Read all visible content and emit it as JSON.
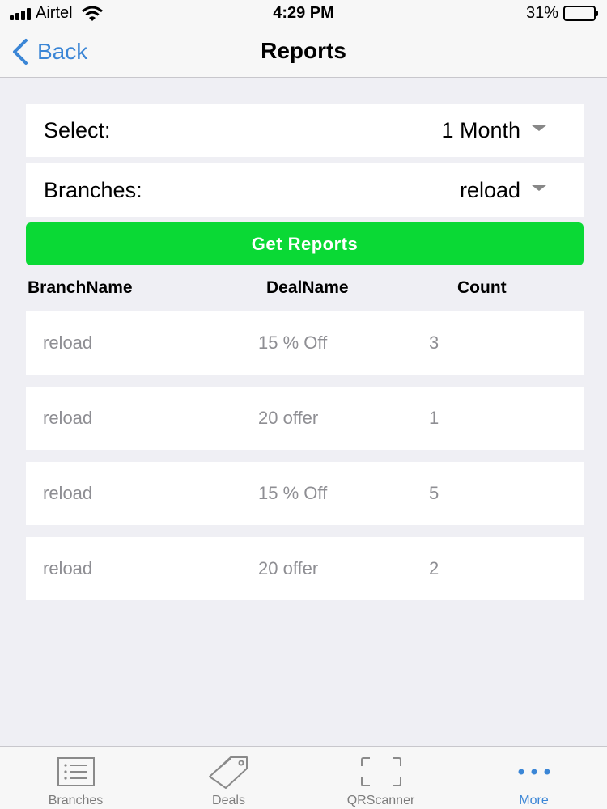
{
  "status_bar": {
    "carrier": "Airtel",
    "time": "4:29 PM",
    "battery": "31%",
    "battery_level": 0.31
  },
  "nav": {
    "back_label": "Back",
    "title": "Reports"
  },
  "filters": {
    "period_label": "Select:",
    "period_value": "1 Month",
    "branch_label": "Branches:",
    "branch_value": "reload"
  },
  "get_reports_label": "Get Reports",
  "table": {
    "headers": [
      "BranchName",
      "DealName",
      "Count"
    ],
    "rows": [
      {
        "branch": "reload",
        "deal": "15 % Off",
        "count": "3"
      },
      {
        "branch": "reload",
        "deal": "20 offer",
        "count": "1"
      },
      {
        "branch": "reload",
        "deal": "15 % Off",
        "count": "5"
      },
      {
        "branch": "reload",
        "deal": "20 offer",
        "count": "2"
      }
    ]
  },
  "tabs": [
    {
      "label": "Branches",
      "icon": "list-icon"
    },
    {
      "label": "Deals",
      "icon": "tag-icon"
    },
    {
      "label": "QRScanner",
      "icon": "qr-scan-icon"
    },
    {
      "label": "More",
      "icon": "more-dots-icon",
      "active": true
    }
  ],
  "colors": {
    "accent": "#3b86d6",
    "button_green": "#0ad935",
    "background": "#efeff4"
  }
}
